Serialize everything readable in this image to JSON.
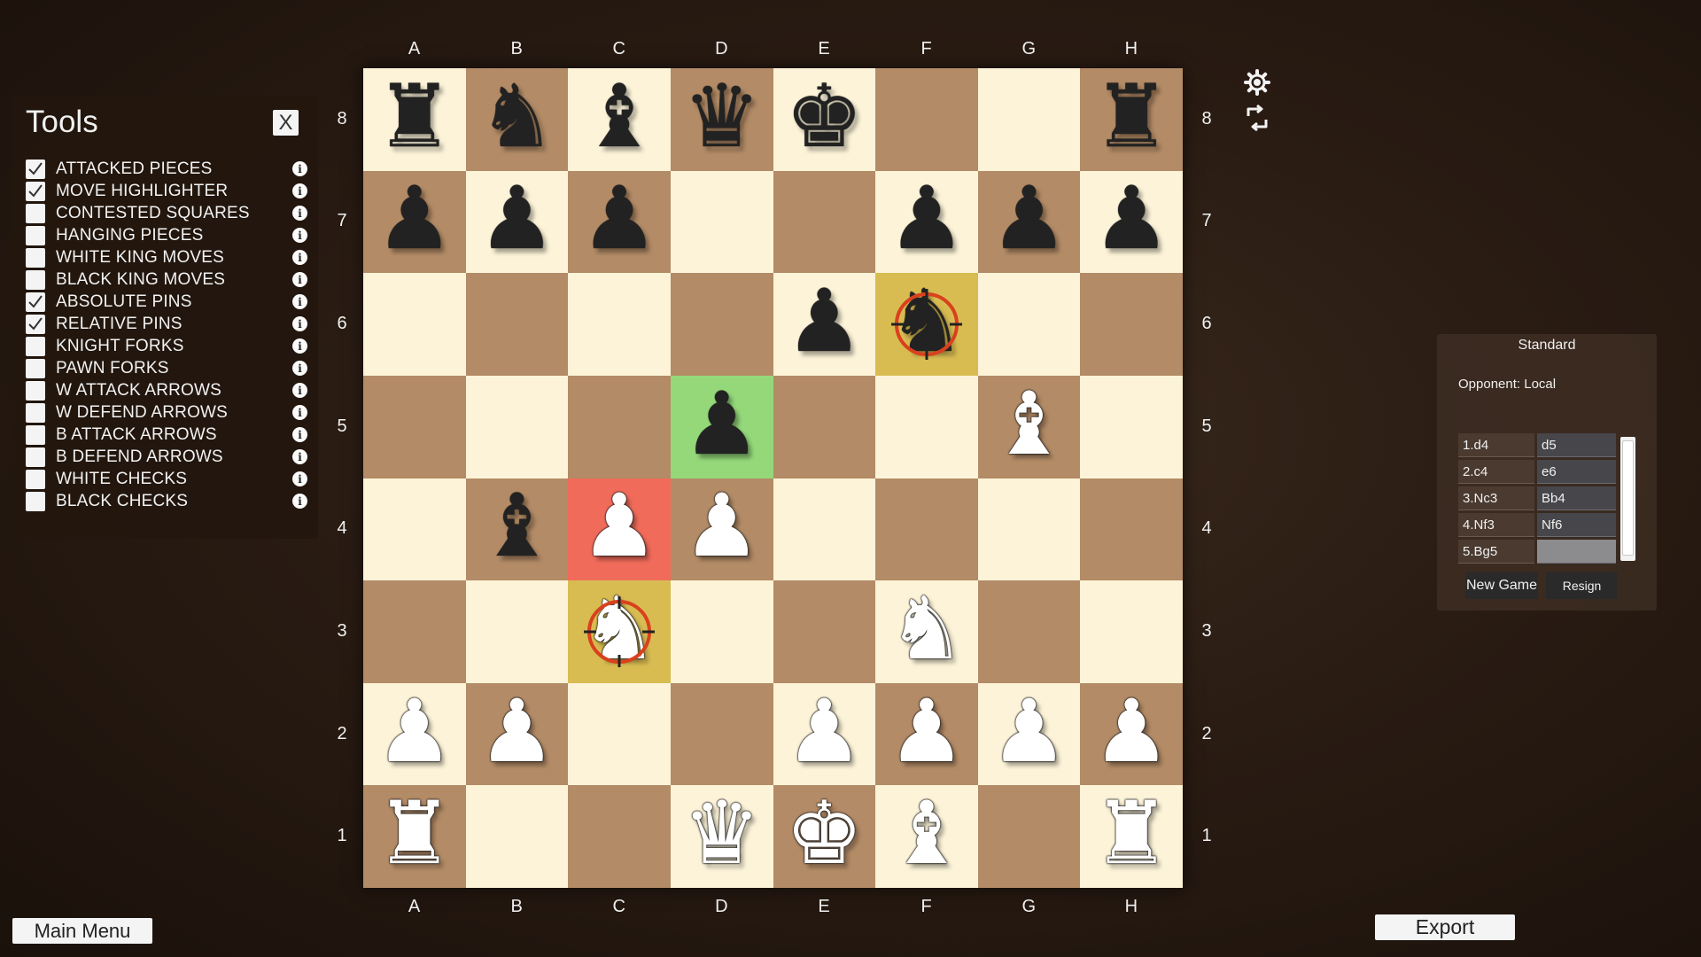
{
  "board": {
    "files": [
      "A",
      "B",
      "C",
      "D",
      "E",
      "F",
      "G",
      "H"
    ],
    "ranks": [
      "8",
      "7",
      "6",
      "5",
      "4",
      "3",
      "2",
      "1"
    ],
    "squares": [
      [
        {
          "piece": "♜",
          "color": "black",
          "name": "black-rook"
        },
        {
          "piece": "♞",
          "color": "black",
          "name": "black-knight"
        },
        {
          "piece": "♝",
          "color": "black",
          "name": "black-bishop"
        },
        {
          "piece": "♛",
          "color": "black",
          "name": "black-queen"
        },
        {
          "piece": "♚",
          "color": "black",
          "name": "black-king"
        },
        null,
        null,
        {
          "piece": "♜",
          "color": "black",
          "name": "black-rook"
        }
      ],
      [
        {
          "piece": "♟",
          "color": "black",
          "name": "black-pawn"
        },
        {
          "piece": "♟",
          "color": "black",
          "name": "black-pawn"
        },
        {
          "piece": "♟",
          "color": "black",
          "name": "black-pawn"
        },
        null,
        null,
        {
          "piece": "♟",
          "color": "black",
          "name": "black-pawn"
        },
        {
          "piece": "♟",
          "color": "black",
          "name": "black-pawn"
        },
        {
          "piece": "♟",
          "color": "black",
          "name": "black-pawn"
        }
      ],
      [
        null,
        null,
        null,
        null,
        {
          "piece": "♟",
          "color": "black",
          "name": "black-pawn"
        },
        {
          "piece": "♞",
          "color": "black",
          "name": "black-knight",
          "highlight": "pin",
          "target": true
        },
        null,
        null
      ],
      [
        null,
        null,
        null,
        {
          "piece": "♟",
          "color": "black",
          "name": "black-pawn",
          "highlight": "from"
        },
        null,
        null,
        {
          "piece": "♝",
          "color": "white",
          "name": "white-bishop"
        },
        null
      ],
      [
        null,
        {
          "piece": "♝",
          "color": "black",
          "name": "black-bishop"
        },
        {
          "piece": "♟",
          "color": "white",
          "name": "white-pawn",
          "highlight": "check"
        },
        {
          "piece": "♟",
          "color": "white",
          "name": "white-pawn"
        },
        null,
        null,
        null,
        null
      ],
      [
        null,
        null,
        {
          "piece": "♞",
          "color": "white",
          "name": "white-knight",
          "highlight": "pin",
          "target": true
        },
        null,
        null,
        {
          "piece": "♞",
          "color": "white",
          "name": "white-knight"
        },
        null,
        null
      ],
      [
        {
          "piece": "♟",
          "color": "white",
          "name": "white-pawn"
        },
        {
          "piece": "♟",
          "color": "white",
          "name": "white-pawn"
        },
        null,
        null,
        {
          "piece": "♟",
          "color": "white",
          "name": "white-pawn"
        },
        {
          "piece": "♟",
          "color": "white",
          "name": "white-pawn"
        },
        {
          "piece": "♟",
          "color": "white",
          "name": "white-pawn"
        },
        {
          "piece": "♟",
          "color": "white",
          "name": "white-pawn"
        }
      ],
      [
        {
          "piece": "♜",
          "color": "white",
          "name": "white-rook"
        },
        null,
        null,
        {
          "piece": "♛",
          "color": "white",
          "name": "white-queen"
        },
        {
          "piece": "♚",
          "color": "white",
          "name": "white-king"
        },
        {
          "piece": "♝",
          "color": "white",
          "name": "white-bishop"
        },
        null,
        {
          "piece": "♜",
          "color": "white",
          "name": "white-rook"
        }
      ]
    ]
  },
  "colors": {
    "light_square": "#fcf3d8",
    "dark_square": "#b38b66",
    "highlight_from": "#94d87a",
    "highlight_check": "#f16b5a",
    "highlight_pin": "#d8bc52",
    "target_ring": "#d9411e"
  },
  "tools": {
    "title": "Tools",
    "close_label": "X",
    "items": [
      {
        "label": "ATTACKED PIECES",
        "checked": true
      },
      {
        "label": "MOVE HIGHLIGHTER",
        "checked": true
      },
      {
        "label": "CONTESTED SQUARES",
        "checked": false
      },
      {
        "label": "HANGING PIECES",
        "checked": false
      },
      {
        "label": "WHITE KING MOVES",
        "checked": false
      },
      {
        "label": "BLACK KING MOVES",
        "checked": false
      },
      {
        "label": "ABSOLUTE PINS",
        "checked": true
      },
      {
        "label": "RELATIVE PINS",
        "checked": true
      },
      {
        "label": "KNIGHT FORKS",
        "checked": false
      },
      {
        "label": "PAWN FORKS",
        "checked": false
      },
      {
        "label": "W ATTACK ARROWS",
        "checked": false
      },
      {
        "label": "W DEFEND ARROWS",
        "checked": false
      },
      {
        "label": "B ATTACK ARROWS",
        "checked": false
      },
      {
        "label": "B DEFEND ARROWS",
        "checked": false
      },
      {
        "label": "WHITE CHECKS",
        "checked": false
      },
      {
        "label": "BLACK CHECKS",
        "checked": false
      }
    ]
  },
  "game_panel": {
    "variant": "Standard",
    "opponent": "Opponent: Local",
    "moves": [
      {
        "white": "1.d4",
        "black": "d5"
      },
      {
        "white": "2.c4",
        "black": "e6"
      },
      {
        "white": "3.Nc3",
        "black": "Bb4"
      },
      {
        "white": "4.Nf3",
        "black": "Nf6"
      },
      {
        "white": "5.Bg5",
        "black": ""
      }
    ],
    "new_game_label": "New Game",
    "resign_label": "Resign"
  },
  "buttons": {
    "main_menu": "Main Menu",
    "export": "Export"
  },
  "icons": {
    "settings": "gear-icon",
    "flip": "flip-board-icon",
    "info": "info-icon",
    "info_glyph": "i",
    "check_glyph": "✓"
  }
}
